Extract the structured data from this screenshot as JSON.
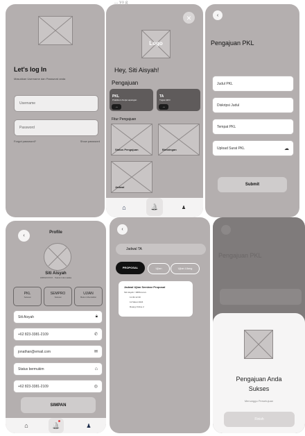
{
  "title_fragment": "... yo                 g",
  "login": {
    "title": "Let's log In",
    "subtitle": "Masukkan Username dan Password anda",
    "username_placeholder": "Username",
    "password_placeholder": "Password",
    "forgot_label": "Forgot password?",
    "show_label": "Show password"
  },
  "home": {
    "logo_text": "Logo",
    "greeting": "Hey, Siti Aisyah!",
    "section_pengajuan": "Pengajuan",
    "card1_title": "PKL",
    "card1_sub": "Praktikum Kerja Lapangan",
    "card1_arrow": "→",
    "card2_title": "TA",
    "card2_sub": "Tugas Akhir",
    "card2_arrow": "→",
    "section_fitur": "Fitur Pengajuan",
    "feat1_label": "Status Pengajuan",
    "feat2_label": "Bimbingan",
    "feat3_label": "Jadwal",
    "close_icon": "×"
  },
  "pkl_form": {
    "back_icon": "‹",
    "title": "Pengajuan PKL",
    "f1": "Judul PKL",
    "f2": "Diskripsi Judul",
    "f3": "Tempat PKL",
    "f4": "Upload Surat PKL",
    "submit": "Submit"
  },
  "profile": {
    "back_icon": "‹",
    "title": "Profile",
    "name": "Siti Aisyah",
    "nim": "18051XXXXX · Teknik Informatika",
    "stat1_title": "PKL",
    "stat1_sub": "Selesai",
    "stat2_title": "SEMPRO",
    "stat2_sub": "Selesai",
    "stat3_title": "UJIAN",
    "stat3_sub": "Belum Mendaftar",
    "row1": "Siti Aisyah",
    "row2": "+62 823-3381-2109",
    "row3": "jonathan@email.com",
    "row4": "Status bermukim",
    "row5": "+62 823-3381-2109",
    "save": "SIMPAN"
  },
  "schedule": {
    "back_icon": "‹",
    "search_value": "Jadwal TA",
    "tab1": "PROPOSAL",
    "tab2": "Ujian",
    "tab3": "Ujian Ulang",
    "card_title": "Jadwal Ujian Seminar Proposal",
    "card_line1": "Siti Aisyah / 1805xxxxxx",
    "card_line2": "11.00-12.30",
    "card_line3": "12 Maret 2024",
    "card_line4": "Ruang Online 2"
  },
  "success": {
    "bg_title": "Pengajuan PKL",
    "title": "Pengajuan Anda Sukses",
    "subtitle": "Menunggu Persetujuan",
    "button": "Finish"
  },
  "nav": {
    "home_icon": "⌂",
    "bell_icon": "🔔",
    "user_icon": "♟"
  },
  "colors": {
    "frame_bg": "#b4afaf",
    "accent_dark": "#1c1c1c",
    "notification_dot": "#e04848"
  }
}
